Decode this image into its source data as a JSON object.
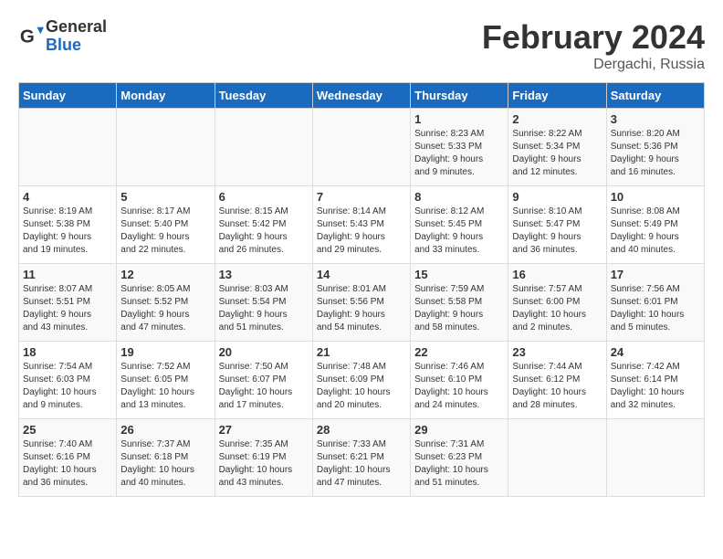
{
  "header": {
    "logo_general": "General",
    "logo_blue": "Blue",
    "month_title": "February 2024",
    "location": "Dergachi, Russia"
  },
  "days_of_week": [
    "Sunday",
    "Monday",
    "Tuesday",
    "Wednesday",
    "Thursday",
    "Friday",
    "Saturday"
  ],
  "weeks": [
    [
      {
        "num": "",
        "info": ""
      },
      {
        "num": "",
        "info": ""
      },
      {
        "num": "",
        "info": ""
      },
      {
        "num": "",
        "info": ""
      },
      {
        "num": "1",
        "info": "Sunrise: 8:23 AM\nSunset: 5:33 PM\nDaylight: 9 hours\nand 9 minutes."
      },
      {
        "num": "2",
        "info": "Sunrise: 8:22 AM\nSunset: 5:34 PM\nDaylight: 9 hours\nand 12 minutes."
      },
      {
        "num": "3",
        "info": "Sunrise: 8:20 AM\nSunset: 5:36 PM\nDaylight: 9 hours\nand 16 minutes."
      }
    ],
    [
      {
        "num": "4",
        "info": "Sunrise: 8:19 AM\nSunset: 5:38 PM\nDaylight: 9 hours\nand 19 minutes."
      },
      {
        "num": "5",
        "info": "Sunrise: 8:17 AM\nSunset: 5:40 PM\nDaylight: 9 hours\nand 22 minutes."
      },
      {
        "num": "6",
        "info": "Sunrise: 8:15 AM\nSunset: 5:42 PM\nDaylight: 9 hours\nand 26 minutes."
      },
      {
        "num": "7",
        "info": "Sunrise: 8:14 AM\nSunset: 5:43 PM\nDaylight: 9 hours\nand 29 minutes."
      },
      {
        "num": "8",
        "info": "Sunrise: 8:12 AM\nSunset: 5:45 PM\nDaylight: 9 hours\nand 33 minutes."
      },
      {
        "num": "9",
        "info": "Sunrise: 8:10 AM\nSunset: 5:47 PM\nDaylight: 9 hours\nand 36 minutes."
      },
      {
        "num": "10",
        "info": "Sunrise: 8:08 AM\nSunset: 5:49 PM\nDaylight: 9 hours\nand 40 minutes."
      }
    ],
    [
      {
        "num": "11",
        "info": "Sunrise: 8:07 AM\nSunset: 5:51 PM\nDaylight: 9 hours\nand 43 minutes."
      },
      {
        "num": "12",
        "info": "Sunrise: 8:05 AM\nSunset: 5:52 PM\nDaylight: 9 hours\nand 47 minutes."
      },
      {
        "num": "13",
        "info": "Sunrise: 8:03 AM\nSunset: 5:54 PM\nDaylight: 9 hours\nand 51 minutes."
      },
      {
        "num": "14",
        "info": "Sunrise: 8:01 AM\nSunset: 5:56 PM\nDaylight: 9 hours\nand 54 minutes."
      },
      {
        "num": "15",
        "info": "Sunrise: 7:59 AM\nSunset: 5:58 PM\nDaylight: 9 hours\nand 58 minutes."
      },
      {
        "num": "16",
        "info": "Sunrise: 7:57 AM\nSunset: 6:00 PM\nDaylight: 10 hours\nand 2 minutes."
      },
      {
        "num": "17",
        "info": "Sunrise: 7:56 AM\nSunset: 6:01 PM\nDaylight: 10 hours\nand 5 minutes."
      }
    ],
    [
      {
        "num": "18",
        "info": "Sunrise: 7:54 AM\nSunset: 6:03 PM\nDaylight: 10 hours\nand 9 minutes."
      },
      {
        "num": "19",
        "info": "Sunrise: 7:52 AM\nSunset: 6:05 PM\nDaylight: 10 hours\nand 13 minutes."
      },
      {
        "num": "20",
        "info": "Sunrise: 7:50 AM\nSunset: 6:07 PM\nDaylight: 10 hours\nand 17 minutes."
      },
      {
        "num": "21",
        "info": "Sunrise: 7:48 AM\nSunset: 6:09 PM\nDaylight: 10 hours\nand 20 minutes."
      },
      {
        "num": "22",
        "info": "Sunrise: 7:46 AM\nSunset: 6:10 PM\nDaylight: 10 hours\nand 24 minutes."
      },
      {
        "num": "23",
        "info": "Sunrise: 7:44 AM\nSunset: 6:12 PM\nDaylight: 10 hours\nand 28 minutes."
      },
      {
        "num": "24",
        "info": "Sunrise: 7:42 AM\nSunset: 6:14 PM\nDaylight: 10 hours\nand 32 minutes."
      }
    ],
    [
      {
        "num": "25",
        "info": "Sunrise: 7:40 AM\nSunset: 6:16 PM\nDaylight: 10 hours\nand 36 minutes."
      },
      {
        "num": "26",
        "info": "Sunrise: 7:37 AM\nSunset: 6:18 PM\nDaylight: 10 hours\nand 40 minutes."
      },
      {
        "num": "27",
        "info": "Sunrise: 7:35 AM\nSunset: 6:19 PM\nDaylight: 10 hours\nand 43 minutes."
      },
      {
        "num": "28",
        "info": "Sunrise: 7:33 AM\nSunset: 6:21 PM\nDaylight: 10 hours\nand 47 minutes."
      },
      {
        "num": "29",
        "info": "Sunrise: 7:31 AM\nSunset: 6:23 PM\nDaylight: 10 hours\nand 51 minutes."
      },
      {
        "num": "",
        "info": ""
      },
      {
        "num": "",
        "info": ""
      }
    ]
  ]
}
